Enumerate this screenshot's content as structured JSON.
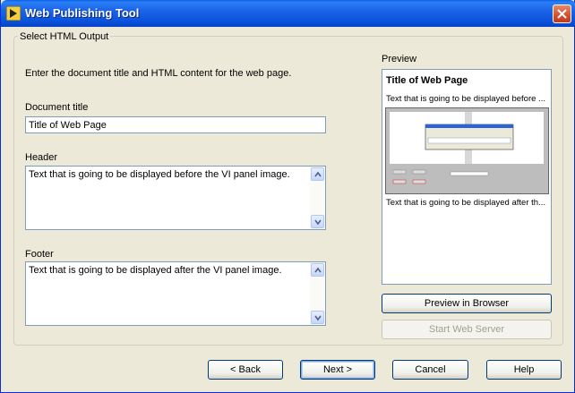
{
  "window": {
    "title": "Web Publishing Tool"
  },
  "group": {
    "label": "Select HTML Output"
  },
  "form": {
    "instructions": "Enter the document title and HTML content for the web page.",
    "doc_title_label": "Document title",
    "doc_title_value": "Title of Web Page",
    "header_label": "Header",
    "header_value": "Text that is going to be displayed before the VI panel image.",
    "footer_label": "Footer",
    "footer_value": "Text that is going to be displayed after the VI panel image."
  },
  "preview": {
    "label": "Preview",
    "title": "Title of Web Page",
    "before_text": "Text that is going to be displayed before ...",
    "after_text": "Text that is going to be displayed after th...",
    "preview_button": "Preview in Browser",
    "server_button": "Start Web Server"
  },
  "buttons": {
    "back": "< Back",
    "next": "Next >",
    "cancel": "Cancel",
    "help": "Help"
  }
}
